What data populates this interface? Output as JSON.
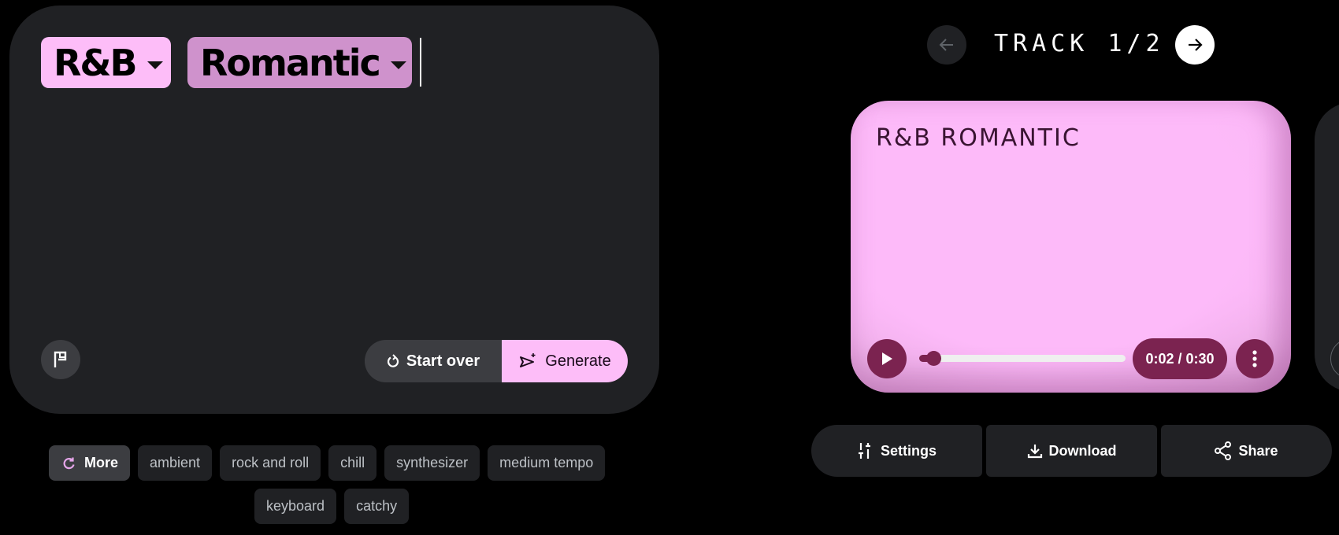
{
  "prompt": {
    "genre_chip": "R&B",
    "mood_chip": "Romantic",
    "start_over_label": "Start over",
    "generate_label": "Generate",
    "icons": {
      "flag": "flag-icon",
      "start_over": "refresh-icon",
      "generate": "send-sparkle-icon",
      "chip_caret": "caret-down-icon"
    }
  },
  "suggestions": {
    "more_label": "More",
    "row1": [
      "ambient",
      "rock and roll",
      "chill",
      "synthesizer",
      "medium tempo"
    ],
    "row2": [
      "keyboard",
      "catchy"
    ]
  },
  "track_nav": {
    "counter": "TRACK 1/2",
    "current": 1,
    "total": 2
  },
  "track": {
    "title": "R&B ROMANTIC",
    "time_display": "0:02 / 0:30",
    "elapsed_seconds": 2,
    "duration_seconds": 30,
    "progress_fraction": 0.067
  },
  "actions": {
    "settings_label": "Settings",
    "download_label": "Download",
    "share_label": "Share"
  },
  "colors": {
    "accent_pink": "#fdbdf8",
    "mood_pink": "#cf92cc",
    "player_plum": "#7b2350",
    "panel_bg": "#202124"
  }
}
